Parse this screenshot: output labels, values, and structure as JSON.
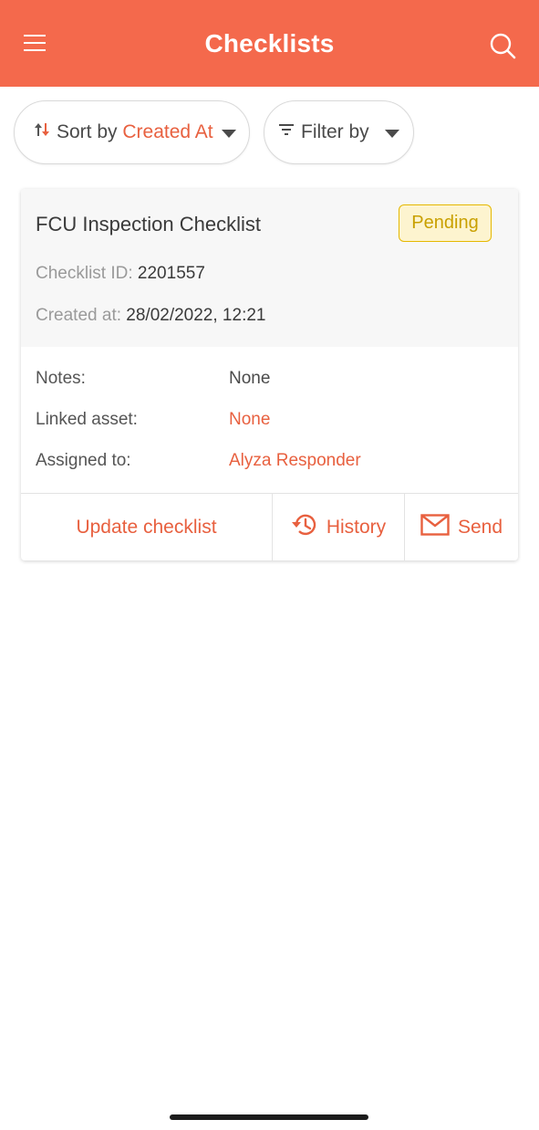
{
  "appbar": {
    "title": "Checklists",
    "menu_icon": "hamburger-menu-icon",
    "search_icon": "search-icon",
    "color": "#f4694c"
  },
  "toolbar": {
    "sort": {
      "prefix": "Sort by",
      "value": "Created At",
      "icon": "sort-icon"
    },
    "filter": {
      "label": "Filter by",
      "icon": "filter-icon"
    }
  },
  "card": {
    "title": "FCU Inspection Checklist",
    "status": "Pending",
    "checklist_id_label": "Checklist ID:",
    "checklist_id": "2201557",
    "created_label": "Created at:",
    "created_value": "28/02/2022, 12:21",
    "fields": {
      "notes_label": "Notes:",
      "notes_value": "None",
      "linked_asset_label": "Linked asset:",
      "linked_asset_value": "None",
      "assigned_label": "Assigned to:",
      "assigned_value": "Alyza Responder"
    },
    "actions": {
      "update": "Update checklist",
      "history": "History",
      "send": "Send"
    }
  },
  "colors": {
    "accent": "#e8603f",
    "pending_bg": "#fdf4cf",
    "pending_text": "#c9a000"
  }
}
